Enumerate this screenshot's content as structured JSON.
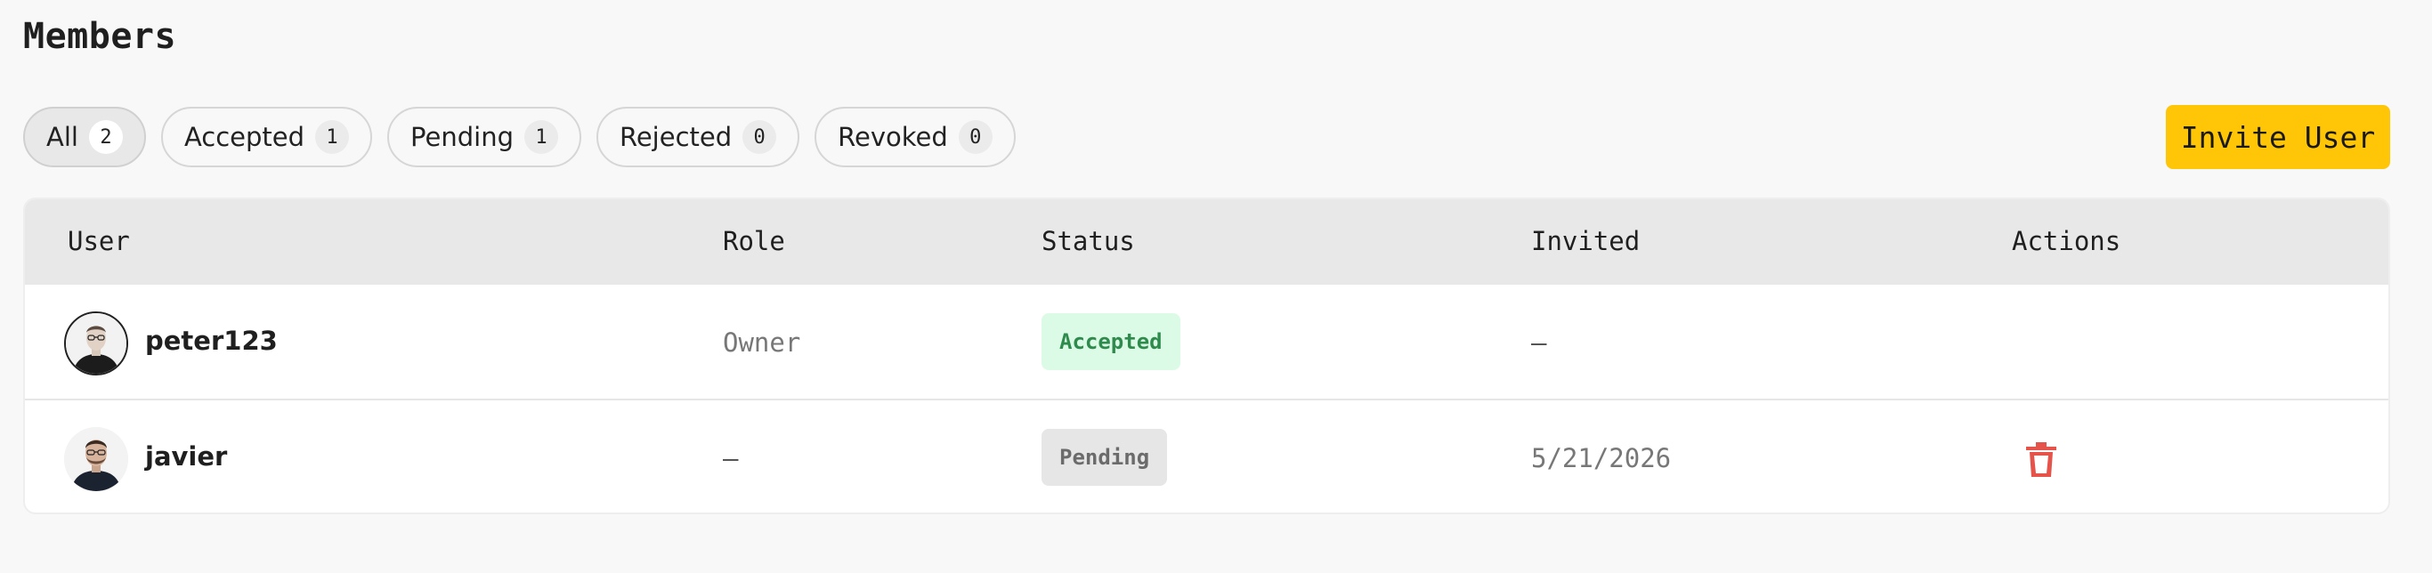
{
  "page": {
    "title": "Members"
  },
  "filters": [
    {
      "label": "All",
      "count": "2",
      "active": true
    },
    {
      "label": "Accepted",
      "count": "1"
    },
    {
      "label": "Pending",
      "count": "1"
    },
    {
      "label": "Rejected",
      "count": "0"
    },
    {
      "label": "Revoked",
      "count": "0"
    }
  ],
  "invite_button": {
    "label": "Invite User"
  },
  "table": {
    "columns": [
      "User",
      "Role",
      "Status",
      "Invited",
      "Actions"
    ],
    "rows": [
      {
        "user": "peter123",
        "role": "Owner",
        "status": "Accepted",
        "invited": "—",
        "avatar": "avatar-photo-peter"
      },
      {
        "user": "javier",
        "role": "—",
        "status": "Pending",
        "invited": "5/21/2026",
        "avatar": "avatar-photo-javier",
        "action": "trash-icon"
      }
    ]
  },
  "colors": {
    "accent": "#ffc608",
    "accepted_bg": "#dcfbe6",
    "accepted_text": "#2f8a4d",
    "pending_bg": "#e6e6e6",
    "delete": "#e5534b"
  }
}
